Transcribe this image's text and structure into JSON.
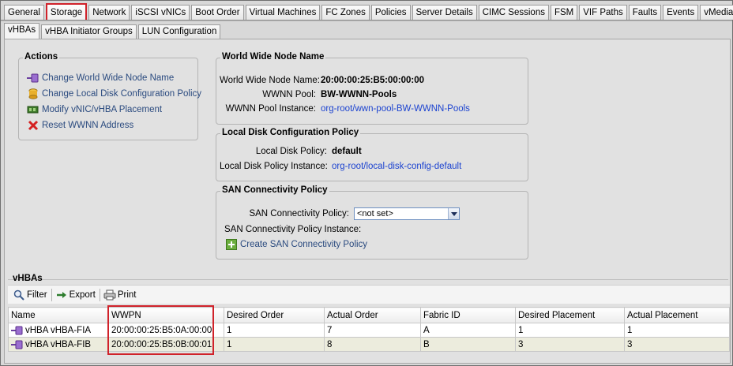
{
  "top_tabs": [
    "General",
    "Storage",
    "Network",
    "iSCSI vNICs",
    "Boot Order",
    "Virtual Machines",
    "FC Zones",
    "Policies",
    "Server Details",
    "CIMC Sessions",
    "FSM",
    "VIF Paths",
    "Faults",
    "Events",
    "vMedia Policy"
  ],
  "active_top_tab": "Storage",
  "sub_tabs": [
    "vHBAs",
    "vHBA Initiator Groups",
    "LUN Configuration"
  ],
  "active_sub_tab": "vHBAs",
  "actions": {
    "title": "Actions",
    "items": [
      {
        "label": "Change World Wide Node Name",
        "icon": "wwnn-icon"
      },
      {
        "label": "Change Local Disk Configuration Policy",
        "icon": "disk-icon"
      },
      {
        "label": "Modify vNIC/vHBA Placement",
        "icon": "placement-icon"
      },
      {
        "label": "Reset WWNN Address",
        "icon": "red-x-icon"
      }
    ]
  },
  "wwnn": {
    "title": "World Wide Node Name",
    "name_label": "World Wide Node Name:",
    "name_value": "20:00:00:25:B5:00:00:00",
    "pool_label": "WWNN Pool:",
    "pool_value": "BW-WWNN-Pools",
    "instance_label": "WWNN Pool Instance:",
    "instance_value": "org-root/wwn-pool-BW-WWNN-Pools"
  },
  "local_disk": {
    "title": "Local Disk Configuration Policy",
    "policy_label": "Local Disk Policy:",
    "policy_value": "default",
    "instance_label": "Local Disk Policy Instance:",
    "instance_value": "org-root/local-disk-config-default"
  },
  "san": {
    "title": "SAN Connectivity Policy",
    "policy_label": "SAN Connectivity Policy:",
    "policy_value": "<not set>",
    "instance_label": "SAN Connectivity Policy Instance:",
    "create_label": "Create SAN Connectivity Policy"
  },
  "vhbas": {
    "title": "vHBAs",
    "toolbar": {
      "filter": "Filter",
      "export": "Export",
      "print": "Print"
    },
    "columns": [
      "Name",
      "WWPN",
      "Desired Order",
      "Actual Order",
      "Fabric ID",
      "Desired Placement",
      "Actual Placement"
    ],
    "rows": [
      [
        "vHBA vHBA-FIA",
        "20:00:00:25:B5:0A:00:00",
        "1",
        "7",
        "A",
        "1",
        "1"
      ],
      [
        "vHBA vHBA-FIB",
        "20:00:00:25:B5:0B:00:01",
        "1",
        "8",
        "B",
        "3",
        "3"
      ]
    ]
  },
  "colors": {
    "highlight": "#d0222a",
    "link": "#1c43d0",
    "action_text": "#2a4a7f"
  }
}
